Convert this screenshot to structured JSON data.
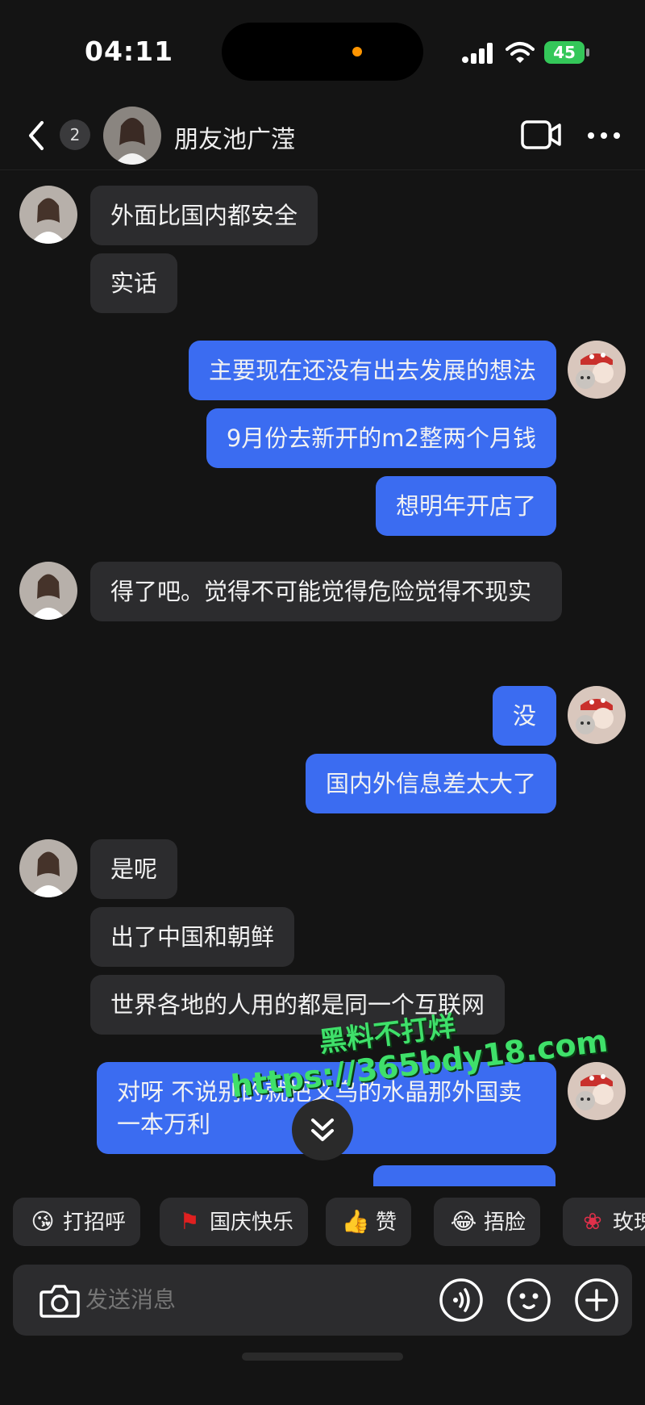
{
  "status": {
    "time": "04:11",
    "battery": "45"
  },
  "header": {
    "unread_count": "2",
    "contact_name": "朋友池广滢"
  },
  "messages": [
    {
      "side": "in",
      "text": "外面比国内都安全"
    },
    {
      "side": "in",
      "text": "实话"
    },
    {
      "side": "out",
      "text": "主要现在还没有出去发展的想法"
    },
    {
      "side": "out",
      "text": "9月份去新开的m2整两个月钱"
    },
    {
      "side": "out",
      "text": "想明年开店了"
    },
    {
      "side": "in",
      "text": "得了吧。觉得不可能觉得危险觉得不现实"
    },
    {
      "side": "out",
      "text": "没"
    },
    {
      "side": "out",
      "text": "国内外信息差太大了"
    },
    {
      "side": "in",
      "text": "是呢"
    },
    {
      "side": "in",
      "text": "出了中国和朝鲜"
    },
    {
      "side": "in",
      "text": "世界各地的人用的都是同一个互联网"
    },
    {
      "side": "out",
      "text": "对呀 不说别的就把义乌的水晶那外国卖一本万利"
    }
  ],
  "watermark": {
    "line1": "黑料不打烊",
    "line2": "https://365bdy18.com"
  },
  "quick_replies": [
    {
      "icon": "smile-heart-icon",
      "label": "打招呼"
    },
    {
      "icon": "red-flag-icon",
      "label": "国庆快乐"
    },
    {
      "icon": "thumbs-up-icon",
      "label": "赞"
    },
    {
      "icon": "facepalm-icon",
      "label": "捂脸"
    },
    {
      "icon": "rose-icon",
      "label": "玫瑰"
    }
  ],
  "input": {
    "placeholder": "发送消息"
  }
}
